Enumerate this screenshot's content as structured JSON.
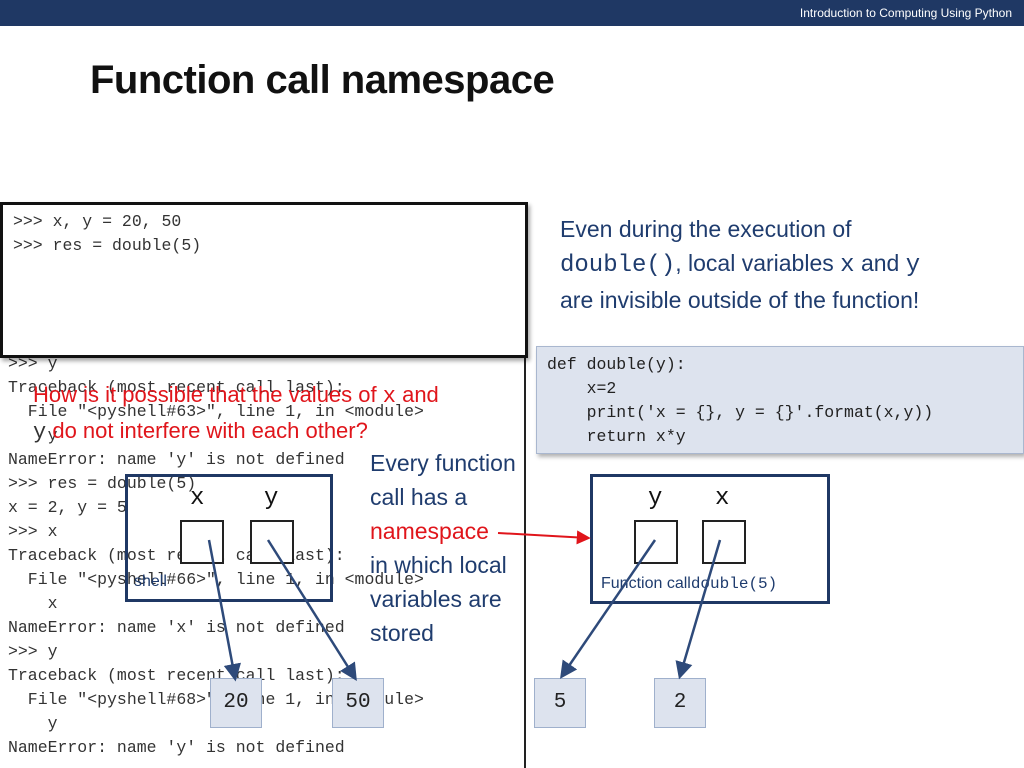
{
  "header": {
    "course": "Introduction to Computing Using Python"
  },
  "slide": {
    "title": "Function call namespace"
  },
  "codebox": {
    "line1": ">>> x, y = 20, 50",
    "line2": ">>> res = double(5)"
  },
  "shell": {
    "lines": [
      ">>> y",
      "Traceback (most recent call last):",
      "  File \"<pyshell#63>\", line 1, in <module>",
      "    y",
      "NameError: name 'y' is not defined",
      ">>> res = double(5)",
      "x = 2, y = 5",
      ">>> x",
      "Traceback (most recent call last):",
      "  File \"<pyshell#66>\", line 1, in <module>",
      "    x",
      "NameError: name 'x' is not defined",
      ">>> y",
      "Traceback (most recent call last):",
      "  File \"<pyshell#68>\", line 1, in <module>",
      "    y",
      "NameError: name 'y' is not defined"
    ]
  },
  "question": {
    "part1": "How is it possible that the values of",
    "var_x": "x",
    "part2": "and",
    "var_y": "y",
    "part3": "do not interfere with each other?"
  },
  "explanation": {
    "part1": "Even during the execution of",
    "func": "double()",
    "part2": ", local variables",
    "var_x": "x",
    "part3": "and",
    "var_y": "y",
    "part4": "are invisible outside of the function!"
  },
  "definition": {
    "lines": [
      "def double(y):",
      "    x=2",
      "    print('x = {}, y = {}'.format(x,y))",
      "    return x*y"
    ]
  },
  "middle_text": {
    "line1": "Every function",
    "line2": "call has a",
    "line3": "namespace",
    "line4": "in which local",
    "line5": "variables are",
    "line6": "stored"
  },
  "shell_namespace": {
    "var1": "x",
    "var2": "y",
    "label": "shell"
  },
  "function_namespace": {
    "var1": "y",
    "var2": "x",
    "label": "Function call",
    "label_code": "double(5)"
  },
  "values": {
    "v1": "20",
    "v2": "50",
    "v3": "5",
    "v4": "2"
  },
  "colors": {
    "accent": "#1f3864",
    "red": "#e0151b",
    "value_fill": "#dde3ee"
  }
}
